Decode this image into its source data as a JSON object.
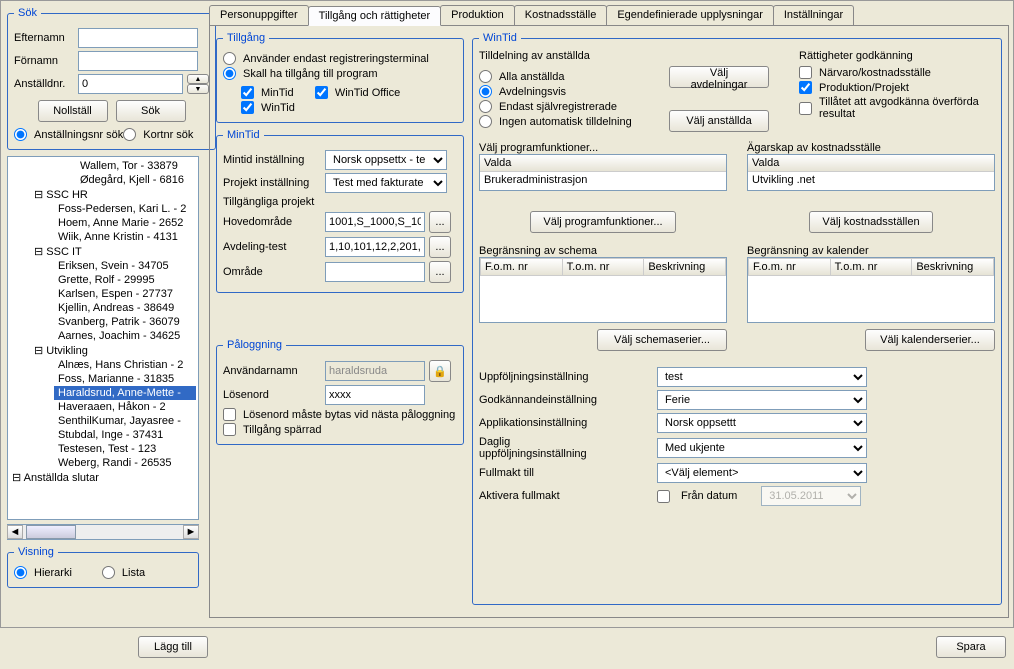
{
  "search": {
    "legend": "Sök",
    "lastname": "Efternamn",
    "firstname": "Förnamn",
    "empno": "Anställdnr.",
    "empno_value": "0",
    "reset": "Nollställ",
    "search_btn": "Sök",
    "radio1": "Anställningsnr sök",
    "radio2": "Kortnr sök"
  },
  "tree": {
    "items": [
      {
        "t": "Wallem, Tor - 33879",
        "l": 3
      },
      {
        "t": "Ødegård, Kjell - 6816",
        "l": 3
      },
      {
        "t": "SSC HR",
        "l": 1,
        "g": true
      },
      {
        "t": "Foss-Pedersen, Kari L. - 2",
        "l": 2
      },
      {
        "t": "Hoem, Anne Marie - 2652",
        "l": 2
      },
      {
        "t": "Wiik, Anne Kristin - 4131",
        "l": 2
      },
      {
        "t": "SSC IT",
        "l": 1,
        "g": true
      },
      {
        "t": "Eriksen, Svein - 34705",
        "l": 2
      },
      {
        "t": "Grette, Rolf - 29995",
        "l": 2
      },
      {
        "t": "Karlsen, Espen - 27737",
        "l": 2
      },
      {
        "t": "Kjellin, Andreas - 38649",
        "l": 2
      },
      {
        "t": "Svanberg, Patrik - 36079",
        "l": 2
      },
      {
        "t": "Aarnes, Joachim - 34625",
        "l": 2
      },
      {
        "t": "Utvikling",
        "l": 1,
        "g": true
      },
      {
        "t": "Alnæs, Hans Christian - 2",
        "l": 2
      },
      {
        "t": "Foss, Marianne - 31835",
        "l": 2
      },
      {
        "t": "Haraldsrud, Anne-Mette -",
        "l": 2,
        "sel": true
      },
      {
        "t": "Haveraaen, Håkon - 2",
        "l": 2
      },
      {
        "t": "SenthilKumar, Jayasree -",
        "l": 2
      },
      {
        "t": "Stubdal, Inge - 37431",
        "l": 2
      },
      {
        "t": "Testesen, Test - 123",
        "l": 2
      },
      {
        "t": "Weberg, Randi - 26535",
        "l": 2
      },
      {
        "t": "Anställda slutar",
        "l": 0,
        "g": true
      }
    ]
  },
  "visning": {
    "legend": "Visning",
    "hierarki": "Hierarki",
    "lista": "Lista"
  },
  "add_btn": "Lägg till",
  "save_btn": "Spara",
  "tabs": [
    "Personuppgifter",
    "Tillgång och rättigheter",
    "Produktion",
    "Kostnadsställe",
    "Egendefinierade upplysningar",
    "Inställningar"
  ],
  "tillgang": {
    "legend": "Tillgång",
    "opt1": "Använder endast registreringsterminal",
    "opt2": "Skall ha tillgång till program",
    "mintid": "MinTid",
    "wintid": "WinTid",
    "wintidoffice": "WinTid Office"
  },
  "mintid": {
    "legend": "MinTid",
    "r1": "Mintid inställning",
    "v1": "Norsk oppsettx - te",
    "r2": "Projekt inställning",
    "v2": "Test med fakturate",
    "r3": "Tillgängliga projekt",
    "r4": "Hovedområde",
    "v4": "1001,S_1000,S_10",
    "r5": "Avdeling-test",
    "v5": "1,10,101,12,2,201,2",
    "r6": "Område"
  },
  "palogg": {
    "legend": "Påloggning",
    "user": "Användarnamn",
    "user_v": "haraldsruda",
    "pass": "Lösenord",
    "pass_v": "xxxx",
    "chk1": "Lösenord måste bytas vid nästa påloggning",
    "chk2": "Tillgång spärrad"
  },
  "wintid": {
    "legend": "WinTid",
    "tilldelning": "Tilldelning av anställda",
    "alla": "Alla anställda",
    "avd": "Avdelningsvis",
    "endast": "Endast självregistrerade",
    "ingen": "Ingen automatisk tilldelning",
    "valj_avd": "Välj avdelningar",
    "valj_anst": "Välj anställda",
    "ratt": "Rättigheter godkänning",
    "narvaro": "Närvaro/kostnadsställe",
    "prod": "Produktion/Projekt",
    "tillatet": "Tillåtet att avgodkänna överförda resultat",
    "pfunk": "Välj programfunktioner...",
    "valda": "Valda",
    "valda_v": "Brukeradministrasjon",
    "pfunk_btn": "Välj programfunktioner...",
    "agar": "Ägarskap av kostnadsställe",
    "agar_v": "Utvikling .net",
    "kost_btn": "Välj kostnadsställen",
    "schema": "Begränsning av schema",
    "kal": "Begränsning av kalender",
    "fom": "F.o.m. nr",
    "tom": "T.o.m. nr",
    "besk": "Beskrivning",
    "schema_btn": "Välj schemaserier...",
    "kal_btn": "Välj kalenderserier...",
    "s1": "Uppföljningsinställning",
    "s1v": "test",
    "s2": "Godkännandeinställning",
    "s2v": "Ferie",
    "s3": "Applikationsinställning",
    "s3v": "Norsk oppsettt",
    "s4": "Daglig uppföljningsinställning",
    "s4v": "Med ukjente",
    "s5": "Fullmakt till",
    "s5v": "<Välj element>",
    "s6": "Aktivera fullmakt",
    "fran": "Från datum",
    "date": "31.05.2011"
  }
}
